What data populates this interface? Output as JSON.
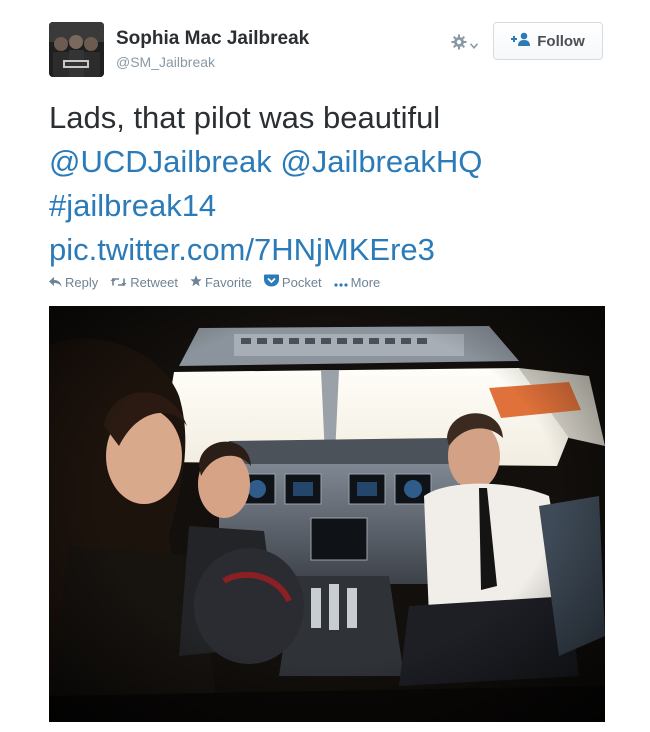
{
  "author": {
    "display_name": "Sophia Mac Jailbreak",
    "handle": "@SM_Jailbreak"
  },
  "header": {
    "follow_label": "Follow"
  },
  "tweet": {
    "text_line": "Lads, that pilot was beautiful",
    "mention_1": "@UCDJailbreak",
    "mention_2": "@JailbreakHQ",
    "hashtag": "#jailbreak14",
    "pic_link": "pic.twitter.com/7HNjMKEre3"
  },
  "actions": {
    "reply": "Reply",
    "retweet": "Retweet",
    "favorite": "Favorite",
    "pocket": "Pocket",
    "more": "More"
  },
  "colors": {
    "link": "#2b7bb9",
    "text": "#292f33",
    "muted": "#8899a6",
    "action": "#6e8496"
  },
  "icons": [
    "gear-icon",
    "chevron-down-icon",
    "follow-person-icon",
    "reply-icon",
    "retweet-icon",
    "favorite-star-icon",
    "pocket-icon",
    "more-dots-icon"
  ]
}
